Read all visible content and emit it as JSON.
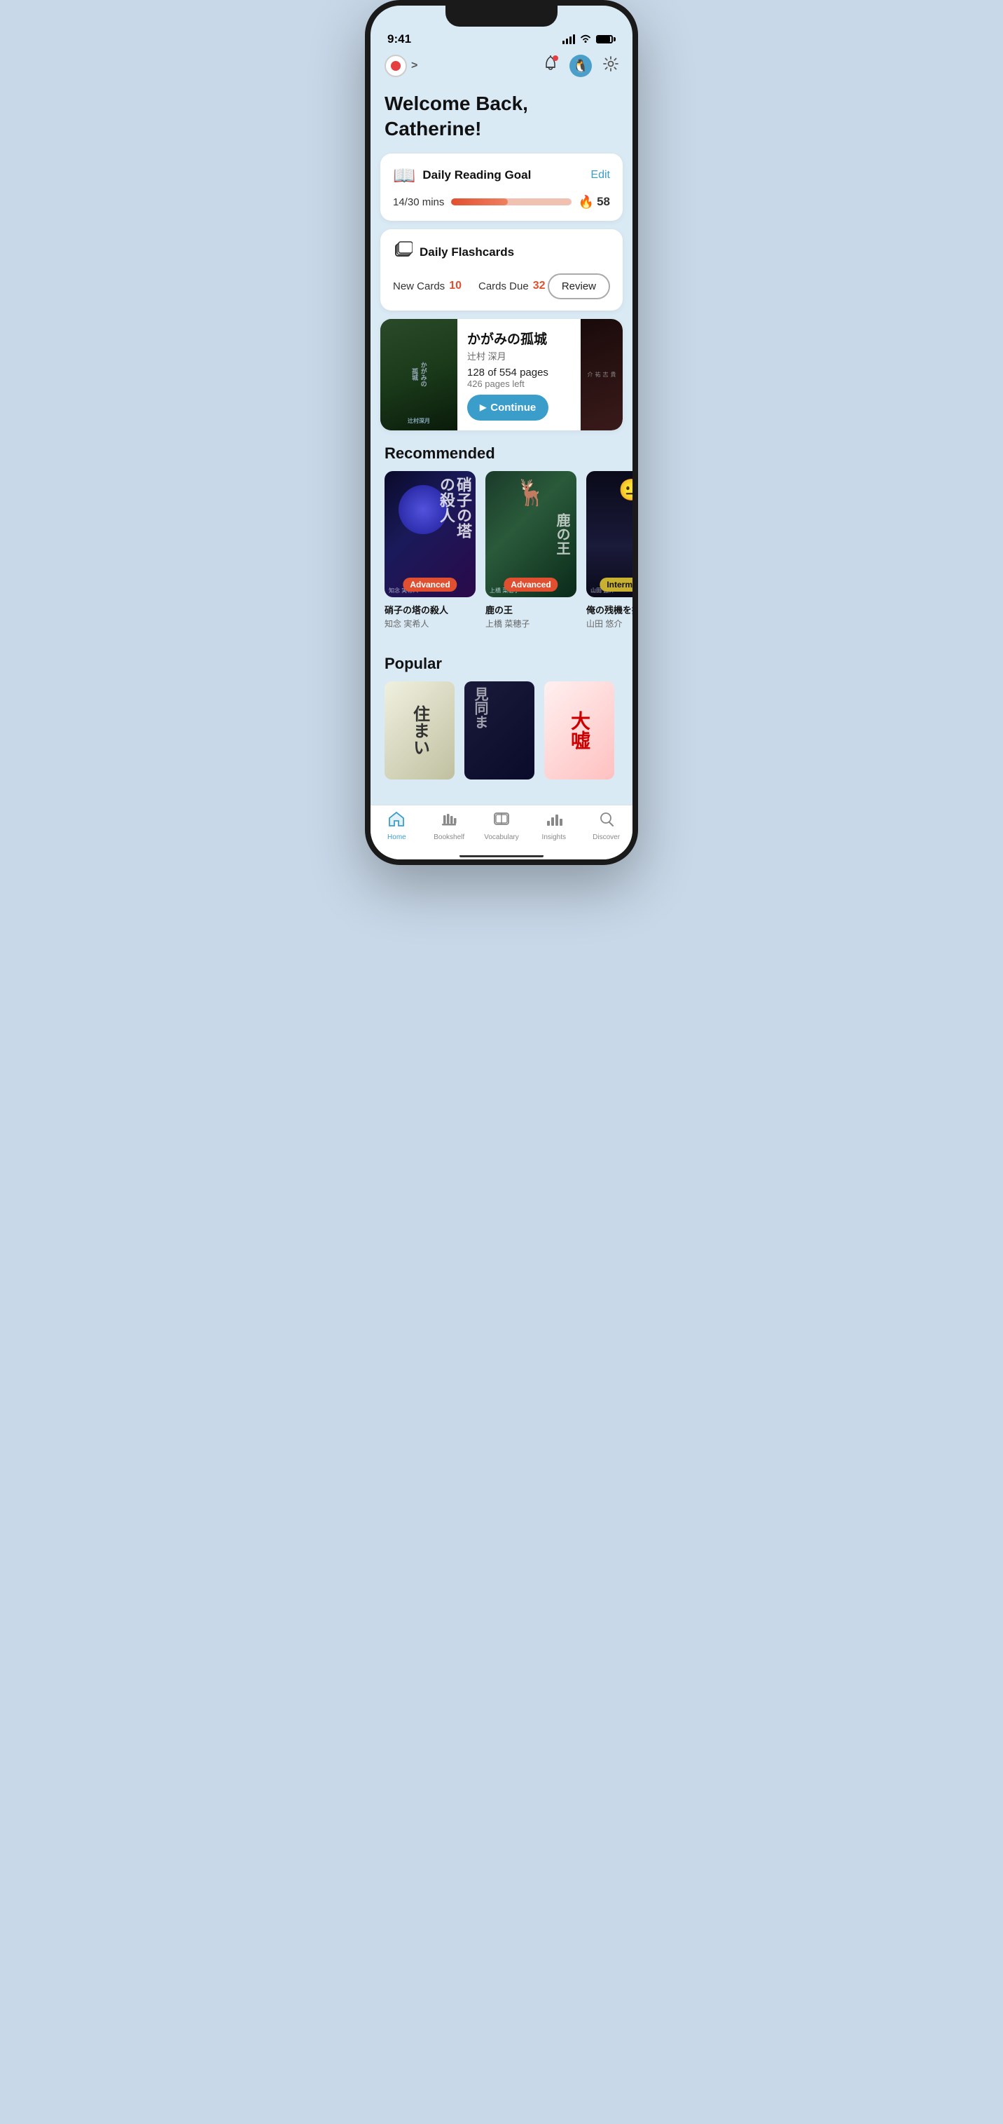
{
  "status_bar": {
    "time": "9:41"
  },
  "top_nav": {
    "chevron": ">",
    "record_label": "record"
  },
  "welcome": {
    "title": "Welcome Back, Catherine!"
  },
  "daily_reading": {
    "title": "Daily Reading Goal",
    "edit_label": "Edit",
    "progress_label": "14/30 mins",
    "progress_percent": 47,
    "streak": "58"
  },
  "daily_flashcards": {
    "title": "Daily Flashcards",
    "new_cards_label": "New Cards",
    "new_cards_value": "10",
    "cards_due_label": "Cards Due",
    "cards_due_value": "32",
    "review_label": "Review"
  },
  "current_book": {
    "title": "かがみの孤城",
    "author": "辻村 深月",
    "progress": "128 of 554 pages",
    "pages_left": "426 pages left",
    "continue_label": "Continue"
  },
  "recommended": {
    "section_title": "Recommended",
    "books": [
      {
        "title": "硝子の塔の殺人",
        "author": "知念 実希人",
        "level": "Advanced",
        "level_type": "advanced"
      },
      {
        "title": "鹿の王",
        "author": "上橋 菜穂子",
        "level": "Advanced",
        "level_type": "advanced"
      },
      {
        "title": "俺の残機を投下し・・",
        "author": "山田 悠介",
        "level": "Intermediate",
        "level_type": "intermediate"
      }
    ]
  },
  "popular": {
    "section_title": "Popular"
  },
  "tab_bar": {
    "items": [
      {
        "label": "Home",
        "active": true
      },
      {
        "label": "Bookshelf",
        "active": false
      },
      {
        "label": "Vocabulary",
        "active": false
      },
      {
        "label": "Insights",
        "active": false
      },
      {
        "label": "Discover",
        "active": false
      }
    ]
  },
  "colors": {
    "accent_blue": "#3b9eca",
    "orange_red": "#e05030",
    "progress_bg": "#f0c0b0"
  }
}
